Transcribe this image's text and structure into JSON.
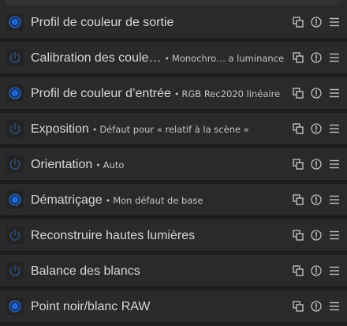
{
  "colors": {
    "power_on": "#1a66d9",
    "power_off": "#2d4f78",
    "icon": "#bfbfbf"
  },
  "modules": [
    {
      "name": "Profil de couleur de sortie",
      "desc": "",
      "enabled": true
    },
    {
      "name": "Calibration des coule…",
      "desc": "Monochro…   a luminance",
      "enabled": false
    },
    {
      "name": "Profil de couleur d’entrée",
      "desc": "RGB Rec2020 linéaire",
      "enabled": true
    },
    {
      "name": "Exposition",
      "desc": "Défaut pour « relatif à la scène »",
      "enabled": false
    },
    {
      "name": "Orientation",
      "desc": "Auto",
      "enabled": false
    },
    {
      "name": "Dématriçage",
      "desc": "Mon défaut de base",
      "enabled": true
    },
    {
      "name": "Reconstruire hautes lumières",
      "desc": "",
      "enabled": false
    },
    {
      "name": "Balance des blancs",
      "desc": "",
      "enabled": false
    },
    {
      "name": "Point noir/blanc RAW",
      "desc": "",
      "enabled": true
    }
  ],
  "icons": {
    "power": "power-icon",
    "multi_instance": "multi-instance-icon",
    "reset": "reset-icon",
    "presets": "presets-menu-icon"
  },
  "separator": "•"
}
